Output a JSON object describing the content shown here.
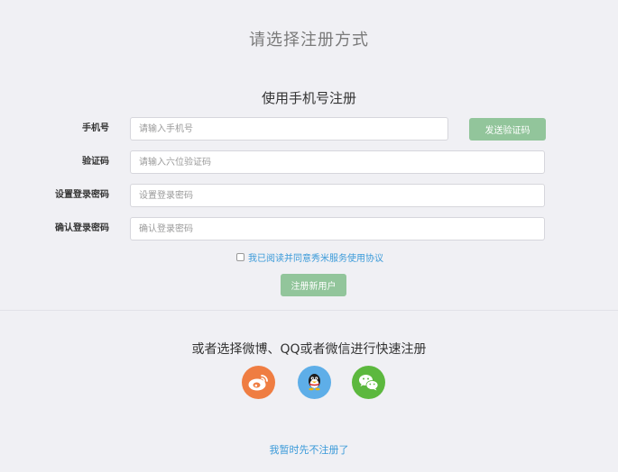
{
  "header": {
    "title": "请选择注册方式"
  },
  "phone_form": {
    "title": "使用手机号注册",
    "fields": [
      {
        "label": "手机号",
        "placeholder": "请输入手机号",
        "value": ""
      },
      {
        "label": "验证码",
        "placeholder": "请输入六位验证码",
        "value": ""
      },
      {
        "label": "设置登录密码",
        "placeholder": "设置登录密码",
        "value": ""
      },
      {
        "label": "确认登录密码",
        "placeholder": "确认登录密码",
        "value": ""
      }
    ],
    "send_code_label": "发送验证码",
    "agreement_label": "我已阅读并同意秀米服务使用协议",
    "agreement_checked": false,
    "register_label": "注册新用户"
  },
  "social": {
    "title": "或者选择微博、QQ或者微信进行快速注册",
    "providers": [
      {
        "icon": "weibo-icon",
        "color": "#ef7d42"
      },
      {
        "icon": "qq-icon",
        "color": "#5eaee8"
      },
      {
        "icon": "wechat-icon",
        "color": "#5cb83e"
      }
    ]
  },
  "footer": {
    "skip_label": "我暂时先不注册了"
  },
  "colors": {
    "accent_green": "#92c59b",
    "link_blue": "#3a9ad9",
    "background": "#f0f0f4"
  }
}
